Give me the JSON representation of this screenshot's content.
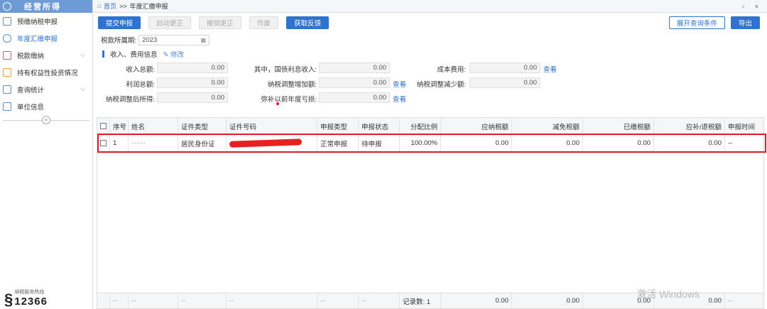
{
  "sidebar": {
    "title": "经营所得",
    "items": [
      {
        "label": "预缴纳税申报"
      },
      {
        "label": "年度汇缴申报"
      },
      {
        "label": "税款缴纳"
      },
      {
        "label": "持有权益性投资情况"
      },
      {
        "label": "查询统计"
      },
      {
        "label": "单位信息"
      }
    ],
    "collapse_label": "«",
    "hotline_label": "纳税服务热线",
    "hotline_number": "12366"
  },
  "breadcrumb": {
    "home": "首页",
    "sep": ">>",
    "current": "年度汇缴申报"
  },
  "window_controls": "▫ ×",
  "toolbar": {
    "submit": "提交申报",
    "start_correction": "启动更正",
    "cancel_correction": "撤销更正",
    "void": "作废",
    "get_feedback": "获取反馈",
    "expand_query": "展开查询条件",
    "export": "导出"
  },
  "period": {
    "label": "税款所属期:",
    "value": "2023"
  },
  "section": {
    "title": "收入、费用信息",
    "edit": "修改"
  },
  "info": {
    "total_income_label": "收入总额:",
    "total_income": "0.00",
    "treasury_interest_label": "其中，国债利息收入:",
    "treasury_interest": "0.00",
    "cost_label": "成本费用:",
    "cost": "0.00",
    "total_profit_label": "利润总额:",
    "total_profit": "0.00",
    "adj_increase_label": "纳税调整增加额:",
    "adj_increase": "0.00",
    "adj_decrease_label": "纳税调整减少额:",
    "adj_decrease": "0.00",
    "adjusted_income_label": "纳税调整后所得:",
    "adjusted_income": "0.00",
    "prior_loss_label": "弥补以前年度亏损:",
    "prior_loss": "0.00",
    "view_link": "查看"
  },
  "table": {
    "headers": [
      "序号",
      "姓名",
      "证件类型",
      "证件号码",
      "申报类型",
      "申报状态",
      "分配比例",
      "应纳税额",
      "减免税额",
      "已缴税额",
      "应补/退税额",
      "申报时间"
    ],
    "row": {
      "index": "1",
      "name": "-----",
      "id_type": "居民身份证",
      "decl_type": "正常申报",
      "status": "待申报",
      "ratio": "100.00%",
      "tax_payable": "0.00",
      "tax_reduction": "0.00",
      "tax_paid": "0.00",
      "tax_refund": "0.00",
      "time": "--"
    },
    "footer": {
      "dash": "--",
      "records": "记录数: 1",
      "tax_payable": "0.00",
      "tax_reduction": "0.00",
      "tax_paid": "0.00",
      "tax_refund": "0.00"
    }
  },
  "watermark": "激活 Windows",
  "colors": {
    "primary": "#2e73d0",
    "highlight": "#e8182a",
    "sidebar_header": "#6d9bd6"
  }
}
